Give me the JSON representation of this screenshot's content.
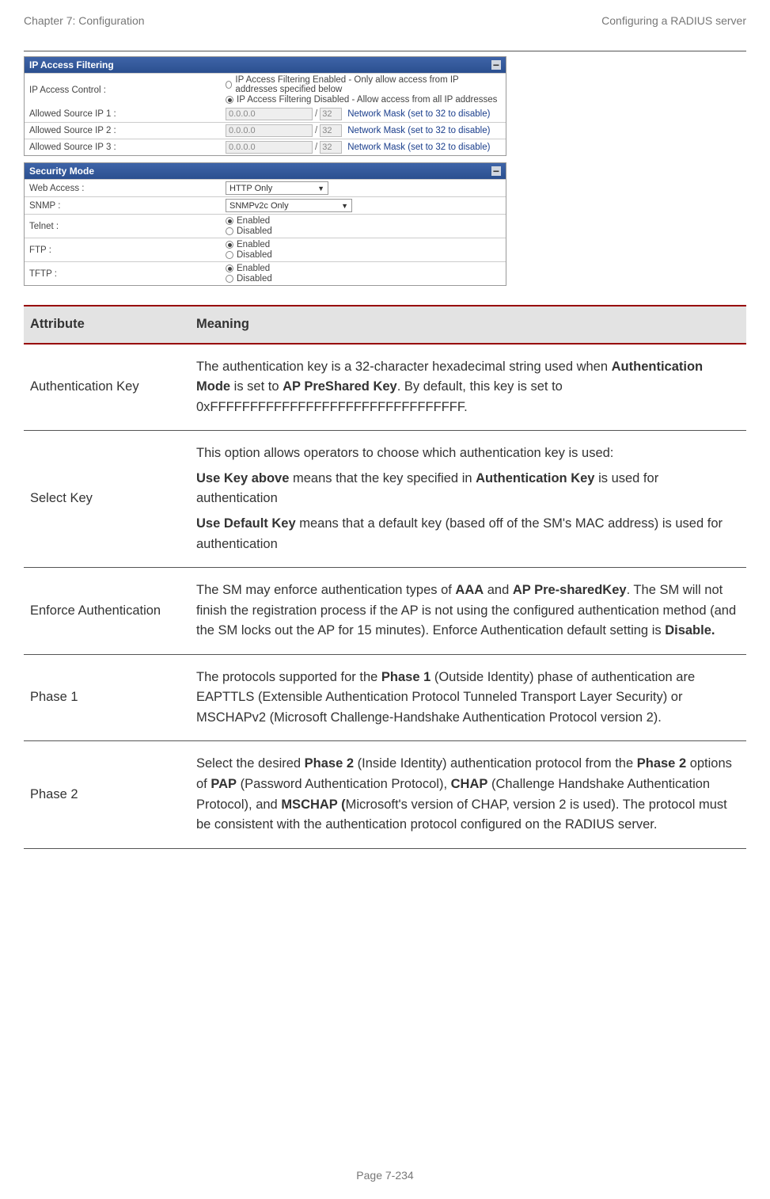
{
  "header": {
    "left": "Chapter 7:  Configuration",
    "right": "Configuring a RADIUS server"
  },
  "panel1": {
    "title": "IP Access Filtering",
    "radio1": "IP Access Filtering Enabled - Only allow access from IP addresses specified below",
    "radio2": "IP Access Filtering Disabled - Allow access from all IP addresses",
    "control_label": "IP Access Control :",
    "rows": [
      {
        "label": "Allowed Source IP 1 :",
        "ip": "0.0.0.0",
        "mask": "32",
        "note": "Network Mask (set to 32 to disable)"
      },
      {
        "label": "Allowed Source IP 2 :",
        "ip": "0.0.0.0",
        "mask": "32",
        "note": "Network Mask (set to 32 to disable)"
      },
      {
        "label": "Allowed Source IP 3 :",
        "ip": "0.0.0.0",
        "mask": "32",
        "note": "Network Mask (set to 32 to disable)"
      }
    ]
  },
  "panel2": {
    "title": "Security Mode",
    "web_label": "Web Access :",
    "web_val": "HTTP Only",
    "snmp_label": "SNMP :",
    "snmp_val": "SNMPv2c Only",
    "telnet_label": "Telnet :",
    "ftp_label": "FTP :",
    "tftp_label": "TFTP :",
    "enabled": "Enabled",
    "disabled": "Disabled"
  },
  "table": {
    "head": {
      "a": "Attribute",
      "m": "Meaning"
    },
    "rows": [
      {
        "attr": "Authentication Key",
        "meaning": [
          {
            "html": "The authentication key is a 32-character hexadecimal string used when <b>Authentication Mode</b> is set to <b>AP PreShared Key</b>. By default, this key is set to 0xFFFFFFFFFFFFFFFFFFFFFFFFFFFFFFFF."
          }
        ]
      },
      {
        "attr": "Select Key",
        "meaning": [
          {
            "html": "This option allows operators to choose which authentication key is used:"
          },
          {
            "html": "<b>Use Key above</b> means that the key specified in <b>Authentication Key</b> is used for authentication"
          },
          {
            "html": "<b>Use Default Key</b> means that a default key (based off of the SM's MAC address) is used for authentication"
          }
        ]
      },
      {
        "attr": "Enforce Authentication",
        "meaning": [
          {
            "html": "The SM may enforce authentication types of <b>AAA</b> and <b>AP Pre-sharedKey</b>. The SM will not finish the registration process if the AP is not using the configured authentication method (and the SM locks out the AP for 15 minutes). Enforce Authentication default setting is <b>Disable.</b>"
          }
        ]
      },
      {
        "attr": "Phase 1",
        "meaning": [
          {
            "html": "The protocols supported for the <b>Phase 1</b> (Outside Identity) phase of authentication are EAPTTLS (Extensible Authentication Protocol Tunneled Transport Layer Security) or MSCHAPv2 (Microsoft Challenge-Handshake Authentication Protocol version 2)."
          }
        ]
      },
      {
        "attr": "Phase 2",
        "meaning": [
          {
            "html": "Select the desired <b>Phase 2</b> (Inside Identity) authentication protocol from the <b>Phase 2</b> options of <b>PAP</b> (Password Authentication Protocol), <b>CHAP</b> (Challenge Handshake Authentication Protocol), and <b>MSCHAP (</b>Microsoft's version of CHAP, version 2 is used). The protocol must be consistent with the authentication protocol configured on the RADIUS server."
          }
        ]
      }
    ]
  },
  "footer": "Page 7-234"
}
